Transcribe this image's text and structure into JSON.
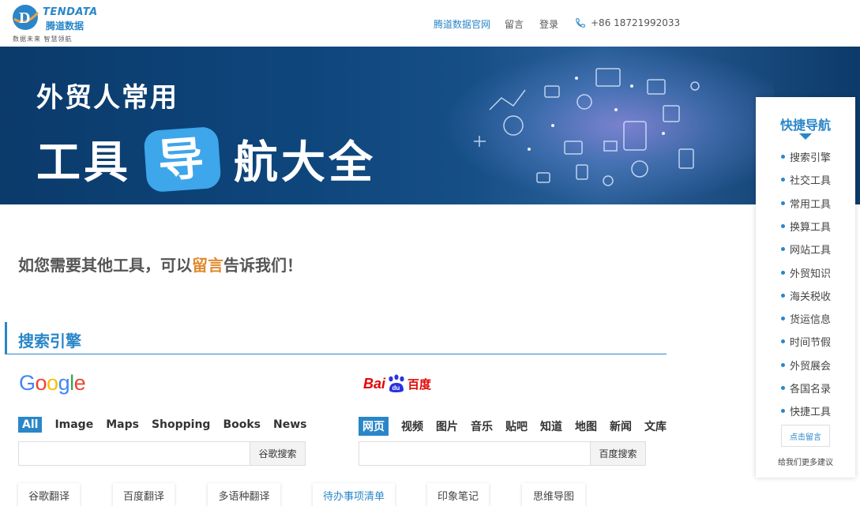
{
  "header": {
    "logo_en": "TENDATA",
    "logo_cn": "腾道数据",
    "logo_slogan": "数据未来   智慧领航",
    "nav": {
      "official": "腾道数据官网",
      "message": "留言",
      "login": "登录",
      "phone": "+86 18721992033"
    }
  },
  "banner": {
    "line1": "外贸人常用",
    "line2_before": "工具",
    "line2_highlight": "导",
    "line2_after": "航大全"
  },
  "message": {
    "before": "如您需要其他工具，可以",
    "highlight": "留言",
    "after": "告诉我们！"
  },
  "section": {
    "title": "搜索引擎"
  },
  "google": {
    "logo": [
      "G",
      "o",
      "o",
      "g",
      "l",
      "e"
    ],
    "logo_colors": [
      "#4285f4",
      "#ea4335",
      "#fbbc05",
      "#4285f4",
      "#34a853",
      "#ea4335"
    ],
    "tabs": [
      "All",
      "Image",
      "Maps",
      "Shopping",
      "Books",
      "News"
    ],
    "active_tab": "All",
    "search_value": "",
    "search_button": "谷歌搜索"
  },
  "baidu": {
    "logo_bai": "Bai",
    "logo_du": "du",
    "logo_cn": "百度",
    "tabs": [
      "网页",
      "视频",
      "图片",
      "音乐",
      "贴吧",
      "知道",
      "地图",
      "新闻",
      "文库"
    ],
    "active_tab": "网页",
    "search_value": "",
    "search_button": "百度搜索"
  },
  "tools": [
    {
      "label": "谷歌翻译",
      "accent": false
    },
    {
      "label": "百度翻译",
      "accent": false
    },
    {
      "label": "多语种翻译",
      "accent": false
    },
    {
      "label": "待办事项清单",
      "accent": true
    },
    {
      "label": "印象笔记",
      "accent": false
    },
    {
      "label": "思维导图",
      "accent": false
    }
  ],
  "quick_nav": {
    "title": "快捷导航",
    "items": [
      "搜索引擎",
      "社交工具",
      "常用工具",
      "换算工具",
      "网站工具",
      "外贸知识",
      "海关税收",
      "货运信息",
      "时间节假",
      "外贸展会",
      "各国名录",
      "快捷工具"
    ],
    "button": "点击留言",
    "note": "给我们更多建议"
  },
  "colors": {
    "accent": "#2a86c8",
    "highlight": "#e08a2e",
    "banner_dark": "#0b3a6b"
  }
}
